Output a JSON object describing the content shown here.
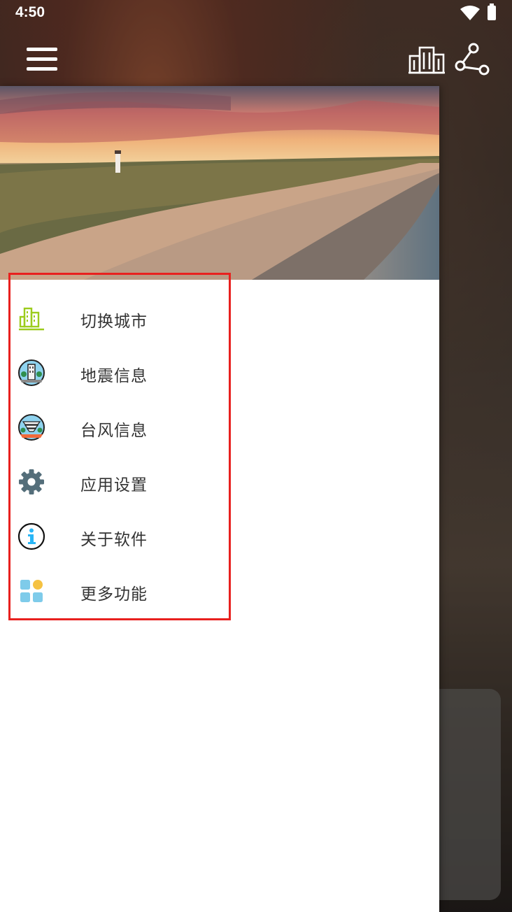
{
  "status_bar": {
    "time": "4:50"
  },
  "app_bar": {
    "menu_icon": "hamburger-menu-icon",
    "city_icon": "city-buildings-icon",
    "share_icon": "share-icon"
  },
  "drawer": {
    "header_image": "coastal-lighthouse-sunset",
    "menu_items": [
      {
        "label": "切换城市",
        "icon": "city-switch-icon"
      },
      {
        "label": "地震信息",
        "icon": "earthquake-icon"
      },
      {
        "label": "台风信息",
        "icon": "typhoon-icon"
      },
      {
        "label": "应用设置",
        "icon": "settings-gear-icon"
      },
      {
        "label": "关于软件",
        "icon": "info-icon"
      },
      {
        "label": "更多功能",
        "icon": "more-apps-icon"
      }
    ]
  },
  "colors": {
    "highlight_border": "#e8201e",
    "city_icon_accent": "#9ccc1c",
    "gear_icon": "#546e7a",
    "info_icon_accent": "#29b6f6",
    "more_apps_blue": "#7ecbea",
    "more_apps_yellow": "#f5c242"
  }
}
